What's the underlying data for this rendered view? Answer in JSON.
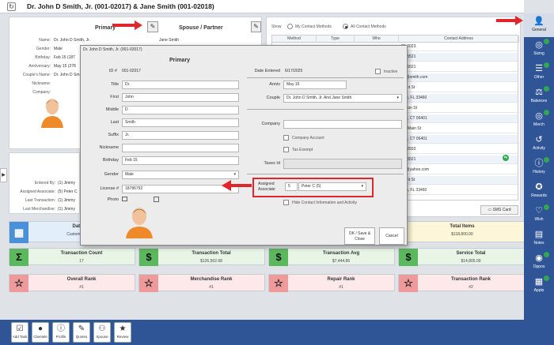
{
  "title": "Dr. John D Smith, Jr. (001-02017) & Jane Smith (001-02018)",
  "primary_panel": {
    "heading": "Primary",
    "spouse_heading": "Spouse / Partner",
    "spouse_name": "Jane Smith",
    "fields": [
      {
        "label": "Name:",
        "value": "Dr. John D Smith, Jr."
      },
      {
        "label": "Gender:",
        "value": "Male"
      },
      {
        "label": "Birthday:",
        "value": "Feb 15 (187"
      },
      {
        "label": "Anniversary:",
        "value": "May 15 (278"
      },
      {
        "label": "Couple's Name:",
        "value": "Dr. John D Sm"
      },
      {
        "label": "Nickname:",
        "value": ""
      },
      {
        "label": "Company:",
        "value": ""
      }
    ],
    "entered": [
      {
        "label": "Entered By:",
        "value": "(1) Jimmy"
      },
      {
        "label": "Assigned Associate:",
        "value": "(5) Peter C"
      },
      {
        "label": "Last Transaction:",
        "value": "(1) Jimmy"
      },
      {
        "label": "Last Merchandise:",
        "value": "(1) Jimmy"
      }
    ]
  },
  "contacts": {
    "show_label": "Show",
    "opt_my": "My Contact Methods",
    "opt_all": "All Contact Methods",
    "columns": [
      "Method",
      "Type",
      "Who",
      "Contact Address"
    ],
    "rows": [
      "20-0023",
      "35-5521",
      "35-5521",
      "hlr@smith.com",
      "mont St",
      "orth, FL 33460",
      "Yukon St",
      "ven, CT 06401",
      "ast Main St",
      "ven, CT 06401",
      "14-2932",
      "35-5521",
      "21@yahoo.com",
      "mont St",
      "orth, FL 33460"
    ],
    "sms_button": "SMS Card"
  },
  "cards_row1": [
    {
      "title": "Date",
      "value": "Customer Si",
      "color": "blue",
      "icon": "calendar-icon"
    },
    {
      "title": "Total Items",
      "value": "$118,800.00",
      "color": "yellow",
      "icon": ""
    }
  ],
  "cards_row2": [
    {
      "title": "Transaction Count",
      "value": "17",
      "icon": "sigma-icon",
      "glyph": "Σ"
    },
    {
      "title": "Transaction Total",
      "value": "$126,562.68",
      "icon": "dollar-icon",
      "glyph": "$"
    },
    {
      "title": "Transaction Avg",
      "value": "$7,444.86",
      "icon": "dollar-icon",
      "glyph": "$"
    },
    {
      "title": "Service Total",
      "value": "$14,805.00",
      "icon": "dollar-icon",
      "glyph": "$"
    }
  ],
  "cards_row3": [
    {
      "title": "Overall Rank",
      "value": "#1",
      "icon": "star-icon",
      "glyph": "☆"
    },
    {
      "title": "Merchandise Rank",
      "value": "#1",
      "icon": "star-icon",
      "glyph": "☆"
    },
    {
      "title": "Repair Rank",
      "value": "#1",
      "icon": "star-icon",
      "glyph": "☆"
    },
    {
      "title": "Transaction Rank",
      "value": "#2",
      "icon": "star-icon",
      "glyph": "☆"
    }
  ],
  "modal": {
    "window_title": "Dr. John D Smith, Jr. (001-02017)",
    "heading": "Primary",
    "id_label": "ID #",
    "id_value": "001-02017",
    "date_entered_label": "Date Entered",
    "date_entered_value": "6/17/2025",
    "inactive_label": "Inactive",
    "left_fields": [
      {
        "label": "Title",
        "value": "Dr."
      },
      {
        "label": "First",
        "value": "John"
      },
      {
        "label": "Middle",
        "value": "D"
      },
      {
        "label": "Last",
        "value": "Smith"
      },
      {
        "label": "Suffix",
        "value": "Jr."
      },
      {
        "label": "Nickname",
        "value": ""
      },
      {
        "label": "Birthday",
        "value": "Feb 15"
      }
    ],
    "gender_label": "Gender",
    "gender_value": "Male",
    "license_label": "License #",
    "license_value": "18786792",
    "photo_label": "Photo",
    "anniv_label": "Anniv",
    "anniv_value": "May 15",
    "couple_label": "Couple",
    "couple_value": "Dr. John D Smith, Jr. And Jane Smith",
    "company_label": "Company",
    "company_account_label": "Company Account",
    "tax_exempt_label": "Tax Exempt",
    "taxes_id_label": "Taxes Id",
    "assigned_label_1": "Assigned",
    "assigned_label_2": "Associate",
    "assigned_num": "5",
    "assigned_value": "Peter C (5)",
    "hide_label": "Hide Contact Information and Activity",
    "ok_label": "OK / Save & Close",
    "cancel_label": "Cancel"
  },
  "rightbar": [
    {
      "label": "General",
      "icon": "person-icon",
      "glyph": "👤"
    },
    {
      "label": "Sizing",
      "icon": "ring-icon",
      "glyph": "◎"
    },
    {
      "label": "Other",
      "icon": "list-icon",
      "glyph": "☰"
    },
    {
      "label": "Balances",
      "icon": "balance-icon",
      "glyph": "⚖"
    },
    {
      "label": "Merch",
      "icon": "ring-icon",
      "glyph": "◎"
    },
    {
      "label": "Activity",
      "icon": "history-icon",
      "glyph": "↺"
    },
    {
      "label": "History",
      "icon": "info-icon",
      "glyph": "ⓘ"
    },
    {
      "label": "Rewards",
      "icon": "ribbon-icon",
      "glyph": "✪"
    },
    {
      "label": "Wish",
      "icon": "wish-icon",
      "glyph": "♡"
    },
    {
      "label": "Notes",
      "icon": "notes-icon",
      "glyph": "▤"
    },
    {
      "label": "Oppos",
      "icon": "oppos-icon",
      "glyph": "◉"
    },
    {
      "label": "Appts",
      "icon": "calendar-icon",
      "glyph": "▦"
    }
  ],
  "bottombar": [
    {
      "label": "Add Task",
      "icon": "task-icon",
      "glyph": "☑"
    },
    {
      "label": "Clientele",
      "icon": "person-icon",
      "glyph": "●"
    },
    {
      "label": "Profile",
      "icon": "info-icon",
      "glyph": "ⓘ"
    },
    {
      "label": "Quotes",
      "icon": "quotes-icon",
      "glyph": "✎"
    },
    {
      "label": "Spouse",
      "icon": "spouse-icon",
      "glyph": "⚇"
    },
    {
      "label": "Review",
      "icon": "review-icon",
      "glyph": "★"
    }
  ]
}
